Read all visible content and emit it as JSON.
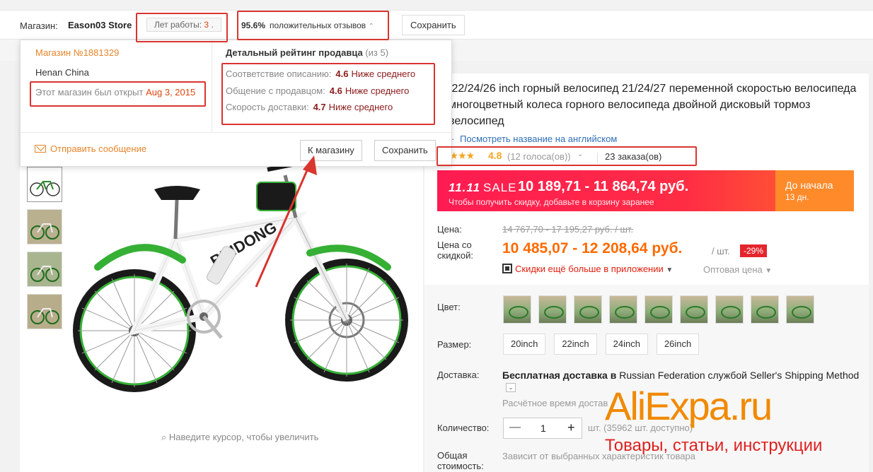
{
  "topbar": {
    "shop_label": "Магазин:",
    "store_name": "Eason03 Store",
    "years_label": "Лет работы:",
    "years_value": "3",
    "years_suffix": ".",
    "feedback_percent": "95.6%",
    "feedback_label": "положительных отзывов",
    "save_label": "Сохранить"
  },
  "popup": {
    "store_number": "Магазин №1881329",
    "location": "Henan China",
    "opened_label": "Этот магазин был открыт",
    "opened_date": "Aug 3, 2015",
    "rating_title": "Детальный рейтинг продавца",
    "rating_scale": "(из 5)",
    "ratings": [
      {
        "label": "Соответствие описанию:",
        "score": "4.6",
        "level": "Ниже среднего"
      },
      {
        "label": "Общение с продавцом:",
        "score": "4.6",
        "level": "Ниже среднего"
      },
      {
        "label": "Скорость доставки:",
        "score": "4.7",
        "level": "Ниже среднего"
      }
    ],
    "message_label": "Отправить сообщение",
    "to_store_label": "К магазину",
    "save_label": "Сохранить"
  },
  "product": {
    "title": "/22/24/26 inch горный велосипед 21/24/27 переменной скоростью велосипеда многоцветный колеса горного велосипеда двойной дисковый тормоз велосипед",
    "english_link": "Посмотреть название на английском",
    "stars": "★★★★",
    "rating": "4.8",
    "votes": "(12 голоса(ов))",
    "orders": "23 заказа(ов)",
    "zoom_hint": "Наведите курсор, чтобы увеличить"
  },
  "sale": {
    "tag": "11.11",
    "tag_word": "SALE",
    "price": "10 189,71 - 11 864,74 руб.",
    "hint": "Чтобы получить скидку, добавьте в корзину заранее",
    "countdown_l1": "До начала",
    "countdown_l2": "13 дн."
  },
  "pricing": {
    "price_label": "Цена:",
    "old_price": "14 767,70 - 17 195,27 руб. / шт.",
    "disc_label": "Цена со скидкой:",
    "current_price": "10 485,07 - 12 208,64 руб.",
    "per_unit": "/ шт.",
    "discount": "-29%",
    "app_discount": "Скидки ещё больше в приложении",
    "wholesale": "Оптовая цена"
  },
  "options": {
    "color_label": "Цвет:",
    "size_label": "Размер:",
    "sizes": [
      "20inch",
      "22inch",
      "24inch",
      "26inch"
    ],
    "shipping_label": "Доставка:",
    "shipping_text_bold": "Бесплатная доставка в",
    "shipping_text_rest": "Russian Federation службой Seller's Shipping Method",
    "shipping_est": "Расчётное время достав",
    "qty_label": "Количество:",
    "qty_value": "1",
    "qty_available": "шт. (35962 шт. доступно)",
    "total_label": "Общая стоимость:",
    "total_note": "Зависит от выбранных характеристик товара"
  },
  "watermark": {
    "brand": "AliExpa.ru",
    "sub": "Товары, статьи, инструкции"
  },
  "colors": {
    "accent_orange": "#ff6a00",
    "annotation_red": "#d9352f",
    "sale_red": "#ff1b52",
    "link_blue": "#2f6fb6"
  }
}
